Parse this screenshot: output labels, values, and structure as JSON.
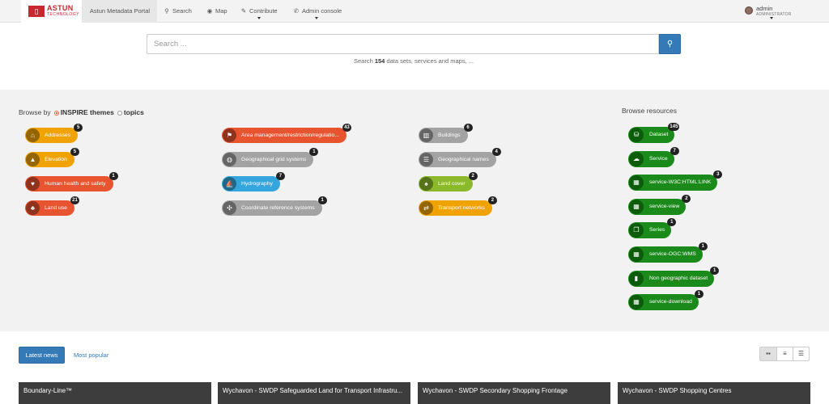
{
  "brand": {
    "logo_text": "ASTUN",
    "logo_sub": "TECHNOLOGY"
  },
  "nav": {
    "portal": "Astun Metadata Portal",
    "items": [
      {
        "label": "Search",
        "icon": "search-icon"
      },
      {
        "label": "Map",
        "icon": "globe-icon"
      },
      {
        "label": "Contribute",
        "icon": "pencil-icon"
      },
      {
        "label": "Admin console",
        "icon": "wrench-icon"
      }
    ]
  },
  "user": {
    "name": "admin",
    "role": "ADMINISTRATOR"
  },
  "search": {
    "placeholder": "Search ...",
    "hint_prefix": "Search",
    "count": "154",
    "hint_suffix": "data sets, services and maps, ..."
  },
  "browse": {
    "by_label": "Browse by",
    "option_inspire": "INSPIRE themes",
    "option_topics": "topics",
    "resources_label": "Browse resources"
  },
  "themes": [
    {
      "label": "Addresses",
      "count": "5",
      "color": "#f0a300",
      "icon": "address-icon"
    },
    {
      "label": "Elevation",
      "count": "5",
      "color": "#f0a300",
      "icon": "elevation-icon"
    },
    {
      "label": "Human health and safety",
      "count": "1",
      "color": "#e85330",
      "icon": "health-icon"
    },
    {
      "label": "Land use",
      "count": "21",
      "color": "#e85330",
      "icon": "land-use-icon"
    },
    {
      "label": "Area management/restriction/regulatio...",
      "count": "43",
      "color": "#e85330",
      "icon": "area-management-icon"
    },
    {
      "label": "Geographical grid systems",
      "count": "1",
      "color": "#a3a3a3",
      "icon": "grid-systems-icon"
    },
    {
      "label": "Hydrography",
      "count": "7",
      "color": "#35a6dd",
      "icon": "hydrography-icon"
    },
    {
      "label": "Coordinate reference systems",
      "count": "1",
      "color": "#a3a3a3",
      "icon": "coordinate-icon"
    },
    {
      "label": "Buildings",
      "count": "6",
      "color": "#a3a3a3",
      "icon": "buildings-icon"
    },
    {
      "label": "Geographical names",
      "count": "4",
      "color": "#a3a3a3",
      "icon": "names-icon"
    },
    {
      "label": "Land cover",
      "count": "2",
      "color": "#8bb92b",
      "icon": "land-cover-icon"
    },
    {
      "label": "Transport networks",
      "count": "2",
      "color": "#f0a300",
      "icon": "transport-icon"
    }
  ],
  "resources": [
    {
      "label": "Dataset",
      "count": "145",
      "icon": "database-icon"
    },
    {
      "label": "Service",
      "count": "7",
      "icon": "cloud-icon"
    },
    {
      "label": "service-W3C:HTML:LINK",
      "count": "3",
      "icon": "table-icon"
    },
    {
      "label": "service-view",
      "count": "2",
      "icon": "table-icon"
    },
    {
      "label": "Series",
      "count": "1",
      "icon": "copy-icon"
    },
    {
      "label": "service-OGC:WMS",
      "count": "1",
      "icon": "table-icon"
    },
    {
      "label": "Non geographic dataset",
      "count": "1",
      "icon": "bar-chart-icon"
    },
    {
      "label": "service-download",
      "count": "1",
      "icon": "table-icon"
    }
  ],
  "news": {
    "tab_latest": "Latest news",
    "tab_popular": "Most popular",
    "views": [
      "grid-view-icon",
      "list-view-icon",
      "compact-list-icon"
    ],
    "cards": [
      "Boundary-Line™",
      "Wychavon - SWDP Safeguarded Land for Transport Infrastru...",
      "Wychavon - SWDP Secondary Shopping Frontage",
      "Wychavon - SWDP Shopping Centres"
    ]
  }
}
